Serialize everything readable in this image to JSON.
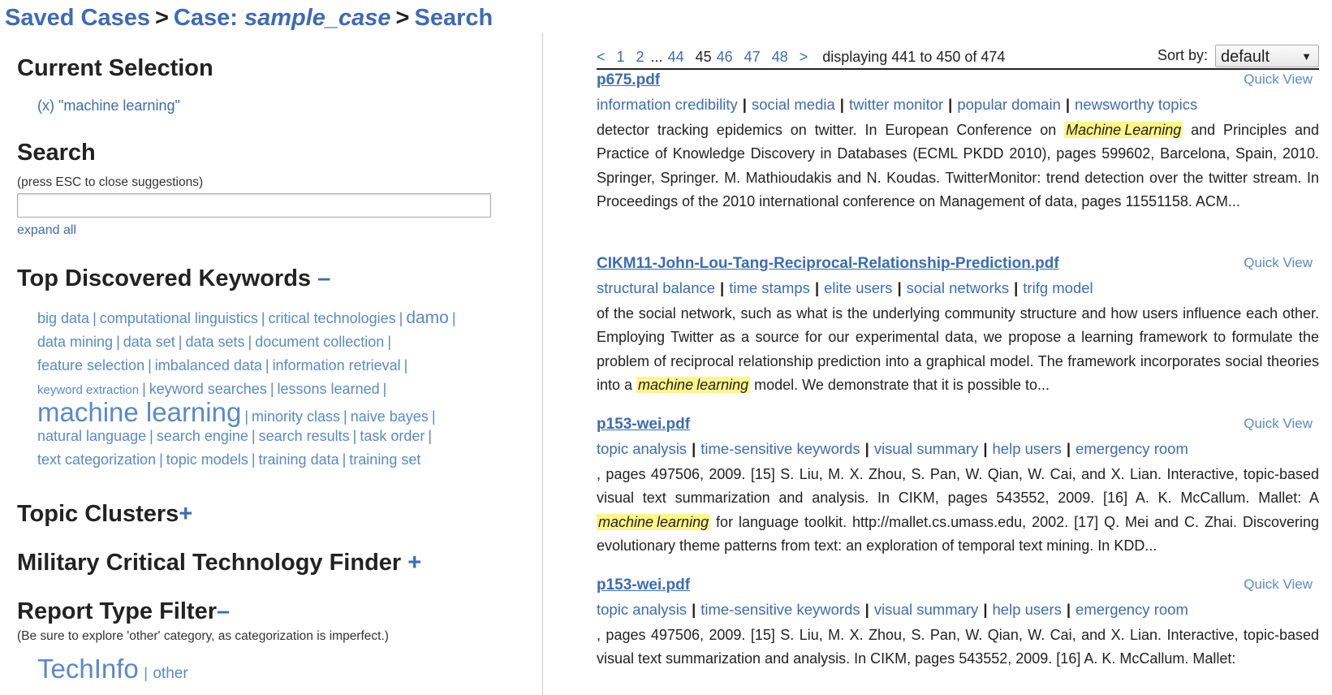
{
  "breadcrumb": {
    "saved_cases": "Saved Cases",
    "sep1": ">",
    "case_prefix": "Case: ",
    "case_name": "sample_case",
    "sep2": ">",
    "search": "Search"
  },
  "left": {
    "current_selection": {
      "heading": "Current Selection",
      "item": "(x) \"machine learning\""
    },
    "search": {
      "heading": "Search",
      "hint": "(press ESC to close suggestions)",
      "value": "",
      "placeholder": "",
      "expand_all": "expand all"
    },
    "keywords": {
      "heading": "Top Discovered Keywords",
      "toggle": "–",
      "rows": [
        [
          [
            "big data",
            18
          ],
          [
            "computational linguistics",
            18
          ],
          [
            "critical technologies",
            18
          ],
          [
            "damo",
            21
          ]
        ],
        [
          [
            "data mining",
            18
          ],
          [
            "data set",
            18
          ],
          [
            "data sets",
            18
          ],
          [
            "document collection",
            18
          ]
        ],
        [
          [
            "feature selection",
            18
          ],
          [
            "imbalanced data",
            18
          ],
          [
            "information retrieval",
            18
          ]
        ],
        [
          [
            "keyword extraction",
            15
          ],
          [
            "keyword searches",
            18
          ],
          [
            "lessons learned",
            18
          ]
        ],
        [
          [
            "machine learning",
            33
          ],
          [
            "minority class",
            18
          ],
          [
            "naive bayes",
            18
          ]
        ],
        [
          [
            "natural language",
            18
          ],
          [
            "search engine",
            18
          ],
          [
            "search results",
            18
          ],
          [
            "task order",
            18
          ]
        ],
        [
          [
            "text categorization",
            18
          ],
          [
            "topic models",
            18
          ],
          [
            "training data",
            18
          ],
          [
            "training set",
            18
          ]
        ]
      ],
      "separator": "|"
    },
    "topic_clusters": {
      "heading": "Topic Clusters",
      "toggle": "+"
    },
    "military": {
      "heading": "Military Critical Technology Finder",
      "toggle": "+"
    },
    "report_filter": {
      "heading": "Report Type Filter",
      "toggle": "–",
      "note": "(Be sure to explore 'other' category, as categorization is imperfect.)",
      "techinfo": "TechInfo",
      "other": "other",
      "separator": "|"
    }
  },
  "pager": {
    "prev": "<",
    "p1": "1",
    "p2": "2",
    "ellipsis": "...",
    "p44": "44",
    "current": "45",
    "p46": "46",
    "p47": "47",
    "p48": "48",
    "next": ">",
    "displaying": "displaying 441 to 450 of 474",
    "sort_label": "Sort by:",
    "sort_value": "default"
  },
  "results": [
    {
      "title": "p675.pdf",
      "quick_view": "Quick View",
      "tags": [
        "information credibility",
        "social media",
        "twitter monitor",
        "popular domain",
        "newsworthy topics"
      ],
      "snippet_before": "detector tracking epidemics on twitter. In European Conference on ",
      "hl1": "Machine",
      "hl2": "Learning",
      "snippet_after": " and Principles and Practice of Knowledge Discovery in Databases (ECML PKDD 2010), pages 599602, Barcelona, Spain, 2010. Springer, Springer. M. Mathioudakis and N. Koudas. TwitterMonitor: trend detection over the twitter stream. In Proceedings of the 2010 international conference on Management of data, pages 11551158. ACM..."
    },
    {
      "title": "CIKM11-John-Lou-Tang-Reciprocal-Relationship-Prediction.pdf",
      "quick_view": "Quick View",
      "tags": [
        "structural balance",
        "time stamps",
        "elite users",
        "social networks",
        "trifg model"
      ],
      "snippet_before": "of the social network, such as what is the underlying community structure and how users influence each other. Employing Twitter as a source for our experimental data, we propose a learning framework to formulate the problem of reciprocal relationship prediction into a graphical model. The framework incorporates social theories into a ",
      "hl1": "machine",
      "hl2": "learning",
      "snippet_after": " model. We demonstrate that it is possible to..."
    },
    {
      "title": "p153-wei.pdf",
      "quick_view": "Quick View",
      "tags": [
        "topic analysis",
        "time-sensitive keywords",
        "visual summary",
        "help users",
        "emergency room"
      ],
      "snippet_before": ", pages 497506, 2009. [15] S. Liu, M. X. Zhou, S. Pan, W. Qian, W. Cai, and X. Lian. Interactive, topic-based visual text summarization and analysis. In CIKM, pages 543552, 2009. [16] A. K. McCallum. Mallet: A ",
      "hl1": "machine",
      "hl2": "learning",
      "snippet_after": " for language toolkit. http://mallet.cs.umass.edu, 2002. [17] Q. Mei and C. Zhai. Discovering evolutionary theme patterns from text: an exploration of temporal text mining. In KDD..."
    },
    {
      "title": "p153-wei.pdf",
      "quick_view": "Quick View",
      "tags": [
        "topic analysis",
        "time-sensitive keywords",
        "visual summary",
        "help users",
        "emergency room"
      ],
      "snippet_before": ", pages 497506, 2009. [15] S. Liu, M. X. Zhou, S. Pan, W. Qian, W. Cai, and X. Lian. Interactive, topic-based visual text summarization and analysis. In CIKM, pages 543552, 2009. [16] A. K. McCallum. Mallet:",
      "hl1": "",
      "hl2": "",
      "snippet_after": ""
    }
  ]
}
